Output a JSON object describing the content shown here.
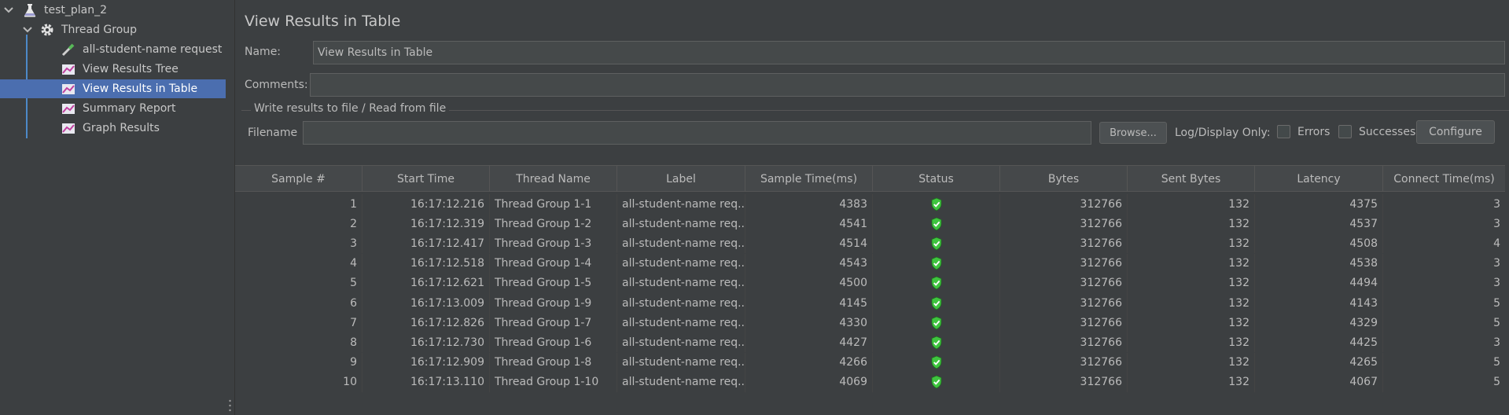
{
  "tree": {
    "items": [
      {
        "label": "test_plan_2"
      },
      {
        "label": "Thread Group"
      },
      {
        "label": "all-student-name request"
      },
      {
        "label": "View Results Tree"
      },
      {
        "label": "View Results in Table"
      },
      {
        "label": "Summary Report"
      },
      {
        "label": "Graph Results"
      }
    ]
  },
  "panel": {
    "title": "View Results in Table",
    "name_label": "Name:",
    "name_value": "View Results in Table",
    "comments_label": "Comments:",
    "comments_value": "",
    "file_group_title": "Write results to file / Read from file",
    "filename_label": "Filename",
    "filename_value": "",
    "browse_label": "Browse...",
    "log_display_label": "Log/Display Only:",
    "errors_label": "Errors",
    "successes_label": "Successes",
    "configure_label": "Configure"
  },
  "table": {
    "columns": [
      "Sample #",
      "Start Time",
      "Thread Name",
      "Label",
      "Sample Time(ms)",
      "Status",
      "Bytes",
      "Sent Bytes",
      "Latency",
      "Connect Time(ms)"
    ],
    "rows": [
      {
        "sample": "1",
        "start": "16:17:12.216",
        "thread": "Thread Group 1-1",
        "label": "all-student-name req...",
        "time": "4383",
        "bytes": "312766",
        "sent": "132",
        "latency": "4375",
        "connect": "3"
      },
      {
        "sample": "2",
        "start": "16:17:12.319",
        "thread": "Thread Group 1-2",
        "label": "all-student-name req...",
        "time": "4541",
        "bytes": "312766",
        "sent": "132",
        "latency": "4537",
        "connect": "3"
      },
      {
        "sample": "3",
        "start": "16:17:12.417",
        "thread": "Thread Group 1-3",
        "label": "all-student-name req...",
        "time": "4514",
        "bytes": "312766",
        "sent": "132",
        "latency": "4508",
        "connect": "4"
      },
      {
        "sample": "4",
        "start": "16:17:12.518",
        "thread": "Thread Group 1-4",
        "label": "all-student-name req...",
        "time": "4543",
        "bytes": "312766",
        "sent": "132",
        "latency": "4538",
        "connect": "3"
      },
      {
        "sample": "5",
        "start": "16:17:12.621",
        "thread": "Thread Group 1-5",
        "label": "all-student-name req...",
        "time": "4500",
        "bytes": "312766",
        "sent": "132",
        "latency": "4494",
        "connect": "3"
      },
      {
        "sample": "6",
        "start": "16:17:13.009",
        "thread": "Thread Group 1-9",
        "label": "all-student-name req...",
        "time": "4145",
        "bytes": "312766",
        "sent": "132",
        "latency": "4143",
        "connect": "5"
      },
      {
        "sample": "7",
        "start": "16:17:12.826",
        "thread": "Thread Group 1-7",
        "label": "all-student-name req...",
        "time": "4330",
        "bytes": "312766",
        "sent": "132",
        "latency": "4329",
        "connect": "5"
      },
      {
        "sample": "8",
        "start": "16:17:12.730",
        "thread": "Thread Group 1-6",
        "label": "all-student-name req...",
        "time": "4427",
        "bytes": "312766",
        "sent": "132",
        "latency": "4425",
        "connect": "3"
      },
      {
        "sample": "9",
        "start": "16:17:12.909",
        "thread": "Thread Group 1-8",
        "label": "all-student-name req...",
        "time": "4266",
        "bytes": "312766",
        "sent": "132",
        "latency": "4265",
        "connect": "5"
      },
      {
        "sample": "10",
        "start": "16:17:13.110",
        "thread": "Thread Group 1-10",
        "label": "all-student-name req...",
        "time": "4069",
        "bytes": "312766",
        "sent": "132",
        "latency": "4067",
        "connect": "5"
      }
    ],
    "status_icon": "success-shield-icon",
    "status_color": "#3fc43f"
  },
  "colors": {
    "background": "#3c3f41",
    "selection": "#4b6eaf",
    "tree_line": "#4d89c8"
  }
}
